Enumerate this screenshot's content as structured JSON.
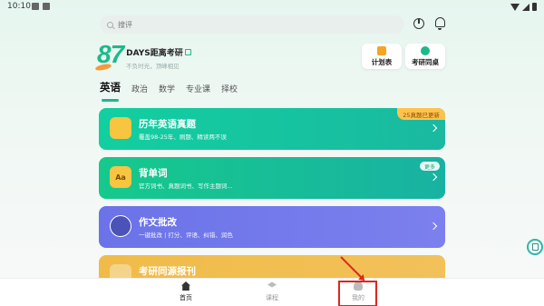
{
  "status_bar": {
    "time": "10:10"
  },
  "search": {
    "placeholder": "搜评"
  },
  "countdown": {
    "days": "87",
    "label": "DAYS距离考研",
    "sub": "不负时光，顶峰相见"
  },
  "quick_links": [
    {
      "label": "计划表",
      "color": "#f5a524"
    },
    {
      "label": "考研同桌",
      "color": "#1db98a"
    }
  ],
  "tabs": [
    {
      "label": "英语",
      "active": true
    },
    {
      "label": "政治",
      "active": false
    },
    {
      "label": "数学",
      "active": false
    },
    {
      "label": "专业课",
      "active": false
    },
    {
      "label": "择校",
      "active": false
    }
  ],
  "cards": [
    {
      "title": "历年英语真题",
      "sub": "覆盖98-25年、刷题、精读两不误",
      "badge": "25真题已更新",
      "icon_text": "",
      "colors": [
        "#12cfa0",
        "#1ab9a0"
      ],
      "icon_bg": "#f7c53f"
    },
    {
      "title": "背单词",
      "sub": "官方词书、真题词书、写作主题词...",
      "badge": "更多",
      "icon_text": "Aa",
      "colors": [
        "#16c98c",
        "#18b2a2"
      ],
      "icon_bg": "#f7c53f"
    },
    {
      "title": "作文批改",
      "sub": "一键批改 | 打分、评语、纠错、润色",
      "badge": "",
      "icon_text": "",
      "colors": [
        "#6b73e8",
        "#7c80ee"
      ],
      "icon_bg": "#4b52b8"
    },
    {
      "title": "考研同源报刊",
      "sub": "",
      "badge": "",
      "icon_text": "",
      "colors": [
        "#f0bb48",
        "#f2c15a"
      ],
      "icon_bg": "#f4d48a"
    }
  ],
  "bottom_nav": [
    {
      "label": "首页",
      "icon": "home-icon",
      "active": true
    },
    {
      "label": "课程",
      "icon": "course-icon",
      "active": false
    },
    {
      "label": "我的",
      "icon": "profile-icon",
      "active": false
    }
  ]
}
